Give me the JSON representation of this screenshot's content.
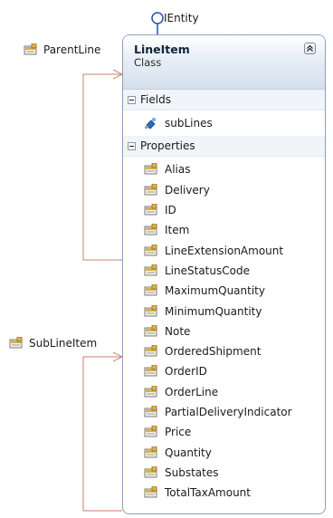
{
  "interface": {
    "label": "IEntity"
  },
  "associations": {
    "parent": "ParentLine",
    "sub": "SubLineItem"
  },
  "class": {
    "name": "LineItem",
    "stereotype": "Class",
    "fields_header": "Fields",
    "fields": [
      "subLines"
    ],
    "properties_header": "Properties",
    "properties": [
      "Alias",
      "Delivery",
      "ID",
      "Item",
      "LineExtensionAmount",
      "LineStatusCode",
      "MaximumQuantity",
      "MinimumQuantity",
      "Note",
      "OrderedShipment",
      "OrderID",
      "OrderLine",
      "PartialDeliveryIndicator",
      "Price",
      "Quantity",
      "Substates",
      "TotalTaxAmount"
    ]
  },
  "colors": {
    "connector": "#c8806a",
    "interface": "#2a4fa8",
    "box_border": "#8da0b8"
  },
  "icons": {
    "property": "property-icon",
    "field": "field-icon",
    "collapse": "chevron-up-icon",
    "interface": "lollipop-icon"
  }
}
